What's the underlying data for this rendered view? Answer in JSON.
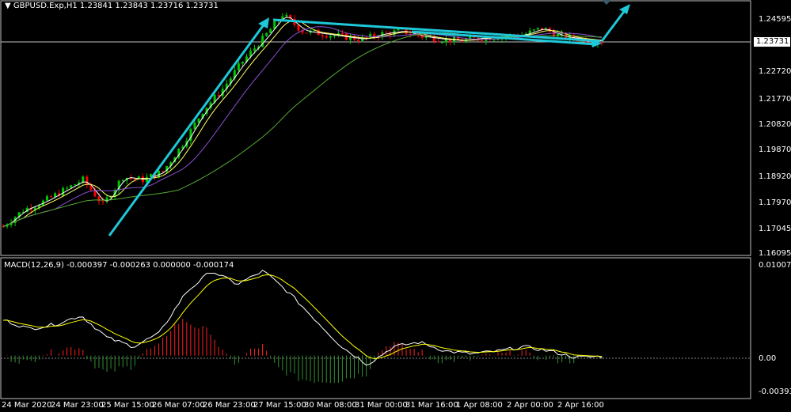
{
  "symbol_header": {
    "arrow_icon": "triangle-down-icon",
    "text": "GBPUSD.Exp,H1  1.23841 1.23843 1.23716 1.23731"
  },
  "indicator_header": {
    "text": "MACD(12,26,9) -0.000397 -0.000263 0.000000 -0.000174"
  },
  "price_axis": {
    "ticks": [
      "1.24595",
      "1.23731",
      "1.22720",
      "1.21770",
      "1.20820",
      "1.19870",
      "1.18920",
      "1.17970",
      "1.17045",
      "1.16095"
    ],
    "current_price": "1.23731"
  },
  "macd_axis": {
    "ticks": [
      "0.010079",
      "0.00",
      "-0.003932"
    ]
  },
  "time_axis": {
    "ticks": [
      "24 Mar 2020",
      "24 Mar 23:00",
      "25 Mar 15:00",
      "26 Mar 07:00",
      "26 Mar 23:00",
      "27 Mar 15:00",
      "30 Mar 08:00",
      "31 Mar 00:00",
      "31 Mar 16:00",
      "1 Apr 08:00",
      "2 Apr 00:00",
      "2 Apr 16:00"
    ]
  },
  "colors": {
    "background": "#000000",
    "bull_candle": "#00c800",
    "bear_candle": "#ff0000",
    "arrows": "#1ec8d8",
    "ma_fast": "#ffffff",
    "ma_mid": "#ffff66",
    "ma_slow": "#8a4fd0",
    "ma_long": "#55aa33",
    "macd_line": "#ffffff",
    "signal_line": "#ffff00",
    "hist_positive": "#ff2020",
    "hist_negative": "#2f8f2f",
    "axis": "#c0c0c0"
  },
  "chart_data": {
    "type": "candlestick",
    "price_path_x_index": [
      0,
      5,
      10,
      15,
      20,
      25,
      30,
      35,
      40,
      45,
      50,
      55,
      60,
      65,
      70,
      75,
      80,
      85,
      90,
      95,
      100,
      105,
      110,
      115,
      120,
      125,
      130,
      135,
      140,
      145,
      150
    ],
    "price_path_close": [
      1.17,
      1.176,
      1.179,
      1.183,
      1.187,
      1.178,
      1.188,
      1.187,
      1.19,
      1.2,
      1.212,
      1.22,
      1.23,
      1.238,
      1.247,
      1.241,
      1.24,
      1.239,
      1.238,
      1.24,
      1.241,
      1.239,
      1.238,
      1.2375,
      1.2385,
      1.239,
      1.2395,
      1.242,
      1.239,
      1.238,
      1.2373
    ],
    "ylim": [
      1.16095,
      1.24595
    ],
    "macd_path": [
      0.004,
      0.003,
      0.0035,
      0.0045,
      0.002,
      0.001,
      0.0025,
      0.007,
      0.0095,
      0.008,
      0.0095,
      0.007,
      0.004,
      0.001,
      -0.001,
      0.001,
      0.0015,
      0.0005,
      0.0002,
      0.0005,
      0.001,
      0.0005,
      -0.0002,
      -0.0001
    ],
    "macd_ylim": [
      -0.003932,
      0.010079
    ]
  }
}
